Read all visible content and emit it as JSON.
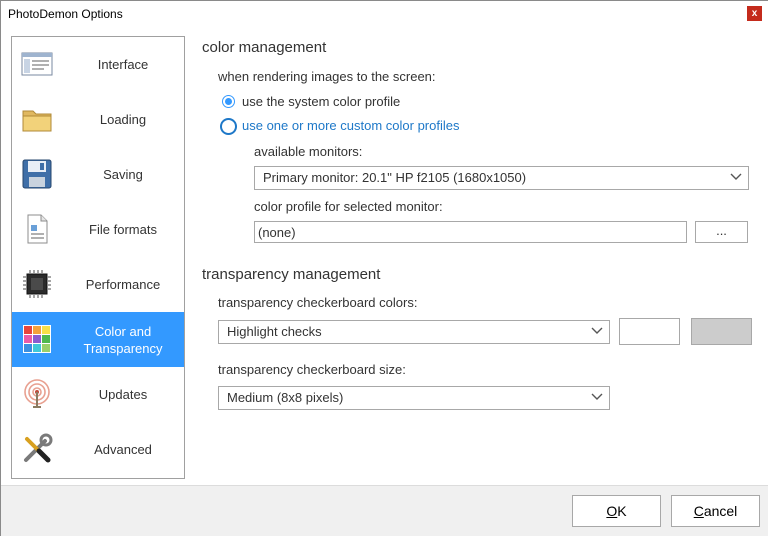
{
  "window": {
    "title": "PhotoDemon Options",
    "close_label": "x"
  },
  "sidebar": {
    "items": [
      {
        "label": "Interface",
        "icon": "interface-window-icon",
        "selected": false
      },
      {
        "label": "Loading",
        "icon": "folder-icon",
        "selected": false
      },
      {
        "label": "Saving",
        "icon": "floppy-disk-icon",
        "selected": false
      },
      {
        "label": "File formats",
        "icon": "document-icon",
        "selected": false
      },
      {
        "label": "Performance",
        "icon": "cpu-chip-icon",
        "selected": false
      },
      {
        "label": "Color and Transparency",
        "icon": "color-grid-icon",
        "selected": true
      },
      {
        "label": "Updates",
        "icon": "broadcast-antenna-icon",
        "selected": false
      },
      {
        "label": "Advanced",
        "icon": "tools-icon",
        "selected": false
      }
    ]
  },
  "color_management": {
    "title": "color management",
    "render_label": "when rendering images to the screen:",
    "option_system": "use the system color profile",
    "option_custom": "use one or more custom color profiles",
    "monitors_label": "available monitors:",
    "monitor_value": "Primary monitor: 20.1\" HP f2105 (1680x1050)",
    "profile_label": "color profile for selected monitor:",
    "profile_value": "(none)",
    "browse_label": "..."
  },
  "transparency_management": {
    "title": "transparency management",
    "checker_colors_label": "transparency checkerboard colors:",
    "checker_colors_value": "Highlight checks",
    "checker_size_label": "transparency checkerboard size:",
    "checker_size_value": "Medium (8x8 pixels)",
    "swatch_colors": [
      "#ffffff",
      "#cccccc"
    ]
  },
  "footer": {
    "ok_underlined": "O",
    "ok_rest": "K",
    "cancel_underlined": "C",
    "cancel_rest": "ancel"
  },
  "colors": {
    "accent": "#3399ff",
    "link": "#1e78c8",
    "close": "#c42b1c"
  }
}
